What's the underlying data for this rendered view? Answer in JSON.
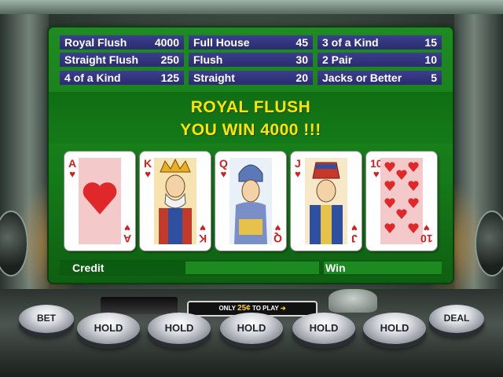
{
  "paytable": [
    {
      "hand": "Royal Flush",
      "payout": "4000"
    },
    {
      "hand": "Full House",
      "payout": "45"
    },
    {
      "hand": "3 of a Kind",
      "payout": "15"
    },
    {
      "hand": "Straight Flush",
      "payout": "250"
    },
    {
      "hand": "Flush",
      "payout": "30"
    },
    {
      "hand": "2 Pair",
      "payout": "10"
    },
    {
      "hand": "4 of a Kind",
      "payout": "125"
    },
    {
      "hand": "Straight",
      "payout": "20"
    },
    {
      "hand": "Jacks or Better",
      "payout": "5"
    }
  ],
  "result": {
    "hand_name": "ROYAL FLUSH",
    "message": "YOU WIN 4000 !!!"
  },
  "cards": [
    {
      "rank": "A",
      "suit": "hearts",
      "suit_symbol": "♥"
    },
    {
      "rank": "K",
      "suit": "hearts",
      "suit_symbol": "♥"
    },
    {
      "rank": "Q",
      "suit": "hearts",
      "suit_symbol": "♥"
    },
    {
      "rank": "J",
      "suit": "hearts",
      "suit_symbol": "♥"
    },
    {
      "rank": "10",
      "suit": "hearts",
      "suit_symbol": "♥"
    }
  ],
  "status": {
    "credit_label": "Credit",
    "win_label": "Win"
  },
  "controls": {
    "bet_label": "BET",
    "hold_label": "HOLD",
    "deal_label": "DEAL",
    "sign_prefix": "ONLY",
    "sign_price": "25¢",
    "sign_suffix": "TO PLAY"
  },
  "colors": {
    "screen_green": "#157a18",
    "paytable_blue": "#2a2d6f",
    "win_text_yellow": "#ffe400",
    "card_red": "#d11e1e"
  }
}
